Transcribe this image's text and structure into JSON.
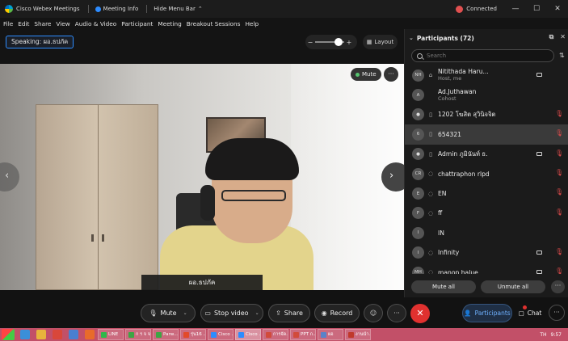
{
  "titlebar": {
    "app_name": "Cisco Webex Meetings",
    "meeting_info": "Meeting Info",
    "hide_menu": "Hide Menu Bar",
    "hide_menu_chevron": "⌃",
    "status": "Connected",
    "minimize": "—",
    "maximize": "☐",
    "close": "✕"
  },
  "menu": [
    "File",
    "Edit",
    "Share",
    "View",
    "Audio & Video",
    "Participant",
    "Meeting",
    "Breakout Sessions",
    "Help"
  ],
  "speaking": "Speaking: ผอ.ธปภัค",
  "zoom": {
    "minus": "−",
    "plus": "+"
  },
  "layout_label": "Layout",
  "video": {
    "nameplate": "ผอ.ธปภัค",
    "mute_label": "Mute",
    "more": "···",
    "prev": "‹",
    "next": "›"
  },
  "participants": {
    "header": "Participants (72)",
    "chevron": "⌄",
    "popout": "⧉",
    "close": "✕",
    "search_placeholder": "Search",
    "sort": "⇅",
    "list": [
      {
        "initials": "NH",
        "device": "⌂",
        "name": "Nitithada Haru...",
        "sub": "Host, me",
        "camera": true,
        "muted": false
      },
      {
        "initials": "A",
        "device": "",
        "name": "Ad.Juthawan",
        "sub": "Cohost",
        "camera": false,
        "muted": false
      },
      {
        "initials": "●",
        "device": "▯",
        "name": "1202 โฆสิต สุวินิจจิต",
        "sub": "",
        "camera": false,
        "muted": true
      },
      {
        "initials": "6",
        "device": "▯",
        "name": "654321",
        "sub": "",
        "camera": false,
        "muted": true
      },
      {
        "initials": "●",
        "device": "▯",
        "name": "Admin ภูมินันท์ ธ.",
        "sub": "",
        "camera": true,
        "muted": true
      },
      {
        "initials": "CR",
        "device": "◌",
        "name": "chattraphon rlpd",
        "sub": "",
        "camera": false,
        "muted": true
      },
      {
        "initials": "E",
        "device": "◌",
        "name": "EN",
        "sub": "",
        "camera": false,
        "muted": true
      },
      {
        "initials": "F",
        "device": "◌",
        "name": "ff",
        "sub": "",
        "camera": false,
        "muted": true
      },
      {
        "initials": "I",
        "device": "",
        "name": "IN",
        "sub": "",
        "camera": false,
        "muted": false
      },
      {
        "initials": "I",
        "device": "◌",
        "name": "Infinity",
        "sub": "",
        "camera": true,
        "muted": true
      },
      {
        "initials": "MH",
        "device": "◌",
        "name": "manop halue",
        "sub": "",
        "camera": true,
        "muted": true
      }
    ],
    "mute_all": "Mute all",
    "unmute_all": "Unmute all",
    "more": "···"
  },
  "controls": {
    "mute": "Mute",
    "stop_video": "Stop video",
    "share": "Share",
    "record": "Record",
    "more": "···",
    "leave": "✕",
    "participants": "Participants",
    "chat": "Chat",
    "end_more": "···"
  },
  "taskbar": {
    "apps": [
      "LINE",
      "ก ร จ จ",
      "Parw...",
      "รุ่น16 ...",
      "Cisco ...",
      "Cisco ...",
      "การจัด...",
      "PPT ก...",
      "ผอ",
      "งานนำ..."
    ],
    "app_colors": [
      "#2fb94a",
      "#3da544",
      "#3da544",
      "#e24a2a",
      "#2d8cff",
      "#2d8cff",
      "#d14b3b",
      "#d14b3b",
      "#5a82c8",
      "#c0392b"
    ],
    "selected_index": 5,
    "clock": "9:57",
    "lang": "TH"
  },
  "colors": {
    "accent": "#2d8cff",
    "leave": "#e0312f",
    "muted_mic": "#e14b4b",
    "taskbar": "#c25068"
  }
}
